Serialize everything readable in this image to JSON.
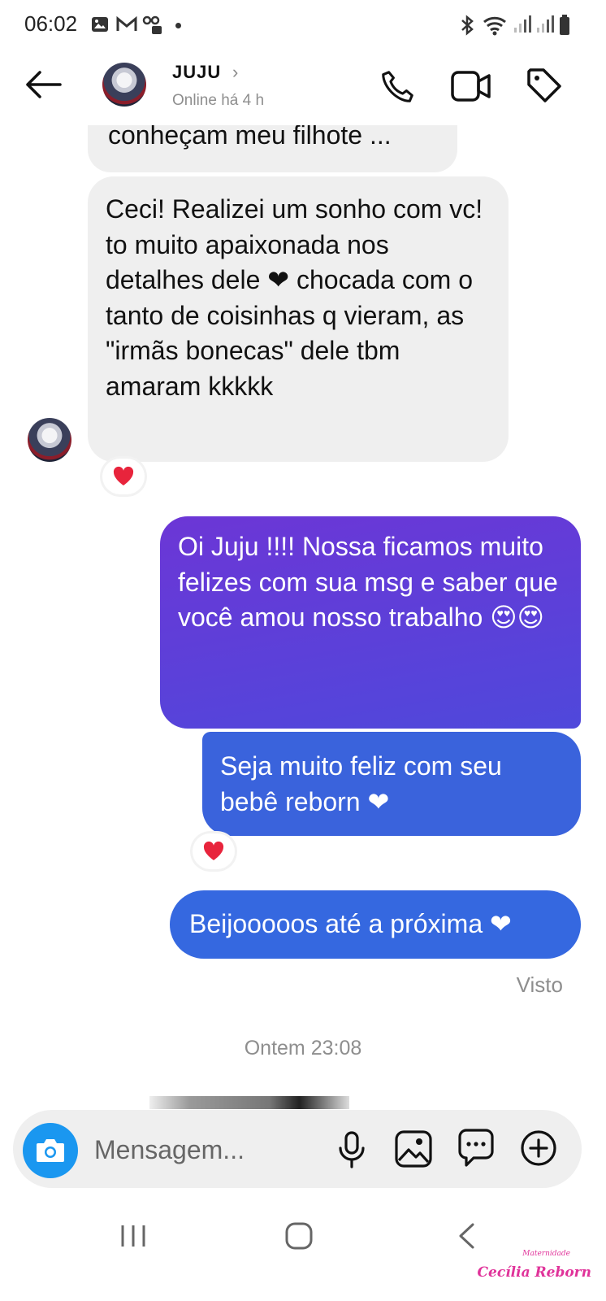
{
  "status_bar": {
    "time": "06:02"
  },
  "header": {
    "name": "JUJU",
    "status": "Online há 4 h"
  },
  "messages": {
    "partial": "conheçam meu filhote ...",
    "in_1": "Ceci! Realizei um sonho com vc! to muito apaixonada nos detalhes dele ❤ chocada com o tanto de coisinhas q vieram, as \"irmãs bonecas\" dele tbm amaram kkkkk",
    "out_1": "Oi Juju !!!! Nossa ficamos muito felizes com sua msg e saber que você amou nosso trabalho 😍😍",
    "out_2": "Seja muito feliz com seu bebê reborn ❤",
    "out_3": "Beijooooos até a próxima ❤"
  },
  "seen_label": "Visto",
  "day_separator": "Ontem 23:08",
  "composer": {
    "placeholder": "Mensagem..."
  },
  "watermark": {
    "small": "Maternidade",
    "brand": "Cecília Reborn"
  },
  "colors": {
    "accent_blue": "#1a97f0",
    "bubble_purple": "#6a3bd8",
    "bubble_blue": "#3a63dc",
    "heart": "#e8243c"
  }
}
